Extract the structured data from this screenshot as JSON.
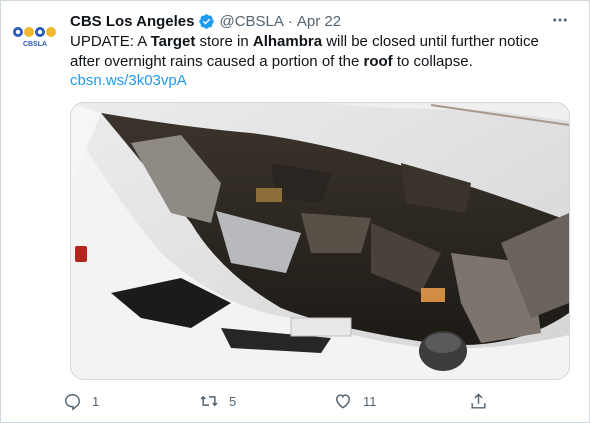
{
  "tweet": {
    "avatar_text": "CBSLA",
    "author_name": "CBS Los Angeles",
    "handle": "@CBSLA",
    "separator": "·",
    "date": "Apr 22",
    "text_parts": [
      {
        "t": "UPDATE: A ",
        "bold": false
      },
      {
        "t": "Target",
        "bold": true
      },
      {
        "t": " store in ",
        "bold": false
      },
      {
        "t": "Alhambra",
        "bold": true
      },
      {
        "t": " will be closed until further notice after overnight rains caused a portion of the ",
        "bold": false
      },
      {
        "t": "roof",
        "bold": true
      },
      {
        "t": " to collapse.",
        "bold": false
      }
    ],
    "link": "cbsn.ws/3k03vpA",
    "media_icon": "photo-roof-collapse",
    "more_icon": "more-horizontal-icon",
    "verified_color": "#1d9bf0"
  },
  "actions": {
    "reply_count": "1",
    "retweet_count": "5",
    "like_count": "11",
    "share_icon": "share-icon"
  },
  "colors": {
    "text": "#0f1419",
    "secondary": "#536471",
    "link": "#1d9bf0",
    "border": "#cfd9de"
  }
}
